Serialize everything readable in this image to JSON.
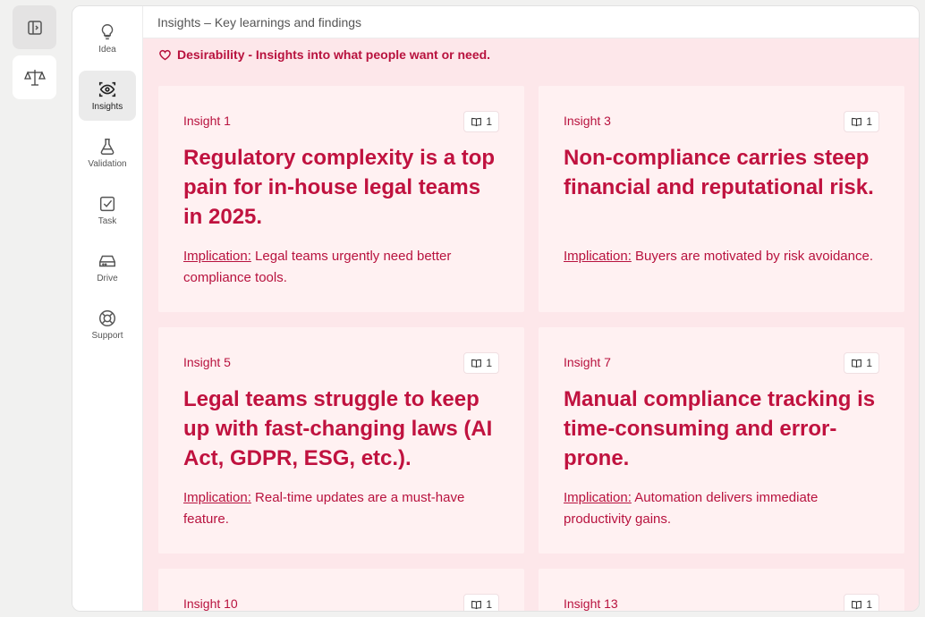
{
  "topbar": {
    "title": "Insights – Key learnings and findings"
  },
  "nav": {
    "items": [
      {
        "label": "Idea"
      },
      {
        "label": "Insights"
      },
      {
        "label": "Validation"
      },
      {
        "label": "Task"
      },
      {
        "label": "Drive"
      },
      {
        "label": "Support"
      }
    ]
  },
  "section": {
    "label": "Desirability - Insights into what people want or need."
  },
  "implication_label": "Implication:",
  "cards": [
    {
      "label": "Insight 1",
      "badge": "1",
      "title": "Regulatory complexity is a top pain for in-house legal teams in 2025.",
      "implication": "Legal teams urgently need better compliance tools."
    },
    {
      "label": "Insight 3",
      "badge": "1",
      "title": "Non-compliance carries steep financial and reputational risk.",
      "implication": "Buyers are motivated by risk avoidance."
    },
    {
      "label": "Insight 5",
      "badge": "1",
      "title": "Legal teams struggle to keep up with fast-changing laws (AI Act, GDPR, ESG, etc.).",
      "implication": "Real-time updates are a must-have feature."
    },
    {
      "label": "Insight 7",
      "badge": "1",
      "title": "Manual compliance tracking is time-consuming and error-prone.",
      "implication": "Automation delivers immediate productivity gains."
    },
    {
      "label": "Insight 10",
      "badge": "1"
    },
    {
      "label": "Insight 13",
      "badge": "1"
    }
  ],
  "colors": {
    "accent": "#c0123f",
    "background": "#fde7ea",
    "card": "#fff1f2"
  }
}
